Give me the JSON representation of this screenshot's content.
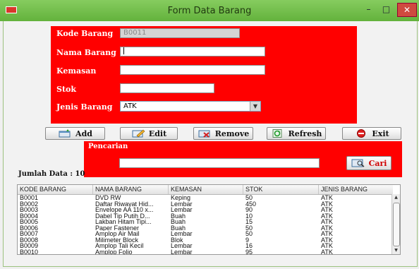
{
  "window": {
    "title": "Form Data Barang",
    "minimize": "–",
    "maximize": "□",
    "close": "✕"
  },
  "form": {
    "kode_label": "Kode Barang",
    "kode_value": "B0011",
    "nama_label": "Nama Barang",
    "nama_value": "",
    "kemasan_label": "Kemasan",
    "kemasan_value": "",
    "stok_label": "Stok",
    "stok_value": "",
    "jenis_label": "Jenis Barang",
    "jenis_value": "ATK"
  },
  "toolbar": {
    "add": "Add",
    "edit": "Edit",
    "remove": "Remove",
    "refresh": "Refresh",
    "exit": "Exit"
  },
  "search": {
    "label": "Pencarian",
    "value": "",
    "button": "Cari"
  },
  "jumlah": "Jumlah Data : 10",
  "table": {
    "columns": [
      "KODE BARANG",
      "NAMA BARANG",
      "KEMASAN",
      "STOK",
      "JENIS BARANG"
    ],
    "rows": [
      [
        "B0001",
        "DVD RW",
        "Keping",
        "50",
        "ATK"
      ],
      [
        "B0002",
        "Daftar Riwayat Hid...",
        "Lembar",
        "450",
        "ATK"
      ],
      [
        "B0003",
        "Envelope AA 110 x...",
        "Lembar",
        "90",
        "ATK"
      ],
      [
        "B0004",
        "Dabel Tip Putih D...",
        "Buah",
        "10",
        "ATK"
      ],
      [
        "B0005",
        "Lakban Hitam Tipi...",
        "Buah",
        "15",
        "ATK"
      ],
      [
        "B0006",
        "Paper Fastener",
        "Buah",
        "50",
        "ATK"
      ],
      [
        "B0007",
        "Amplop Air Mail",
        "Lembar",
        "50",
        "ATK"
      ],
      [
        "B0008",
        "Milimeter Block",
        "Blok",
        "9",
        "ATK"
      ],
      [
        "B0009",
        "Amplop Tali Kecil",
        "Lembar",
        "16",
        "ATK"
      ],
      [
        "B0010",
        "Amplop Folio",
        "Lembar",
        "95",
        "ATK"
      ]
    ]
  },
  "colors": {
    "panel": "#ff0000",
    "titlebar": "#6cbf45"
  }
}
